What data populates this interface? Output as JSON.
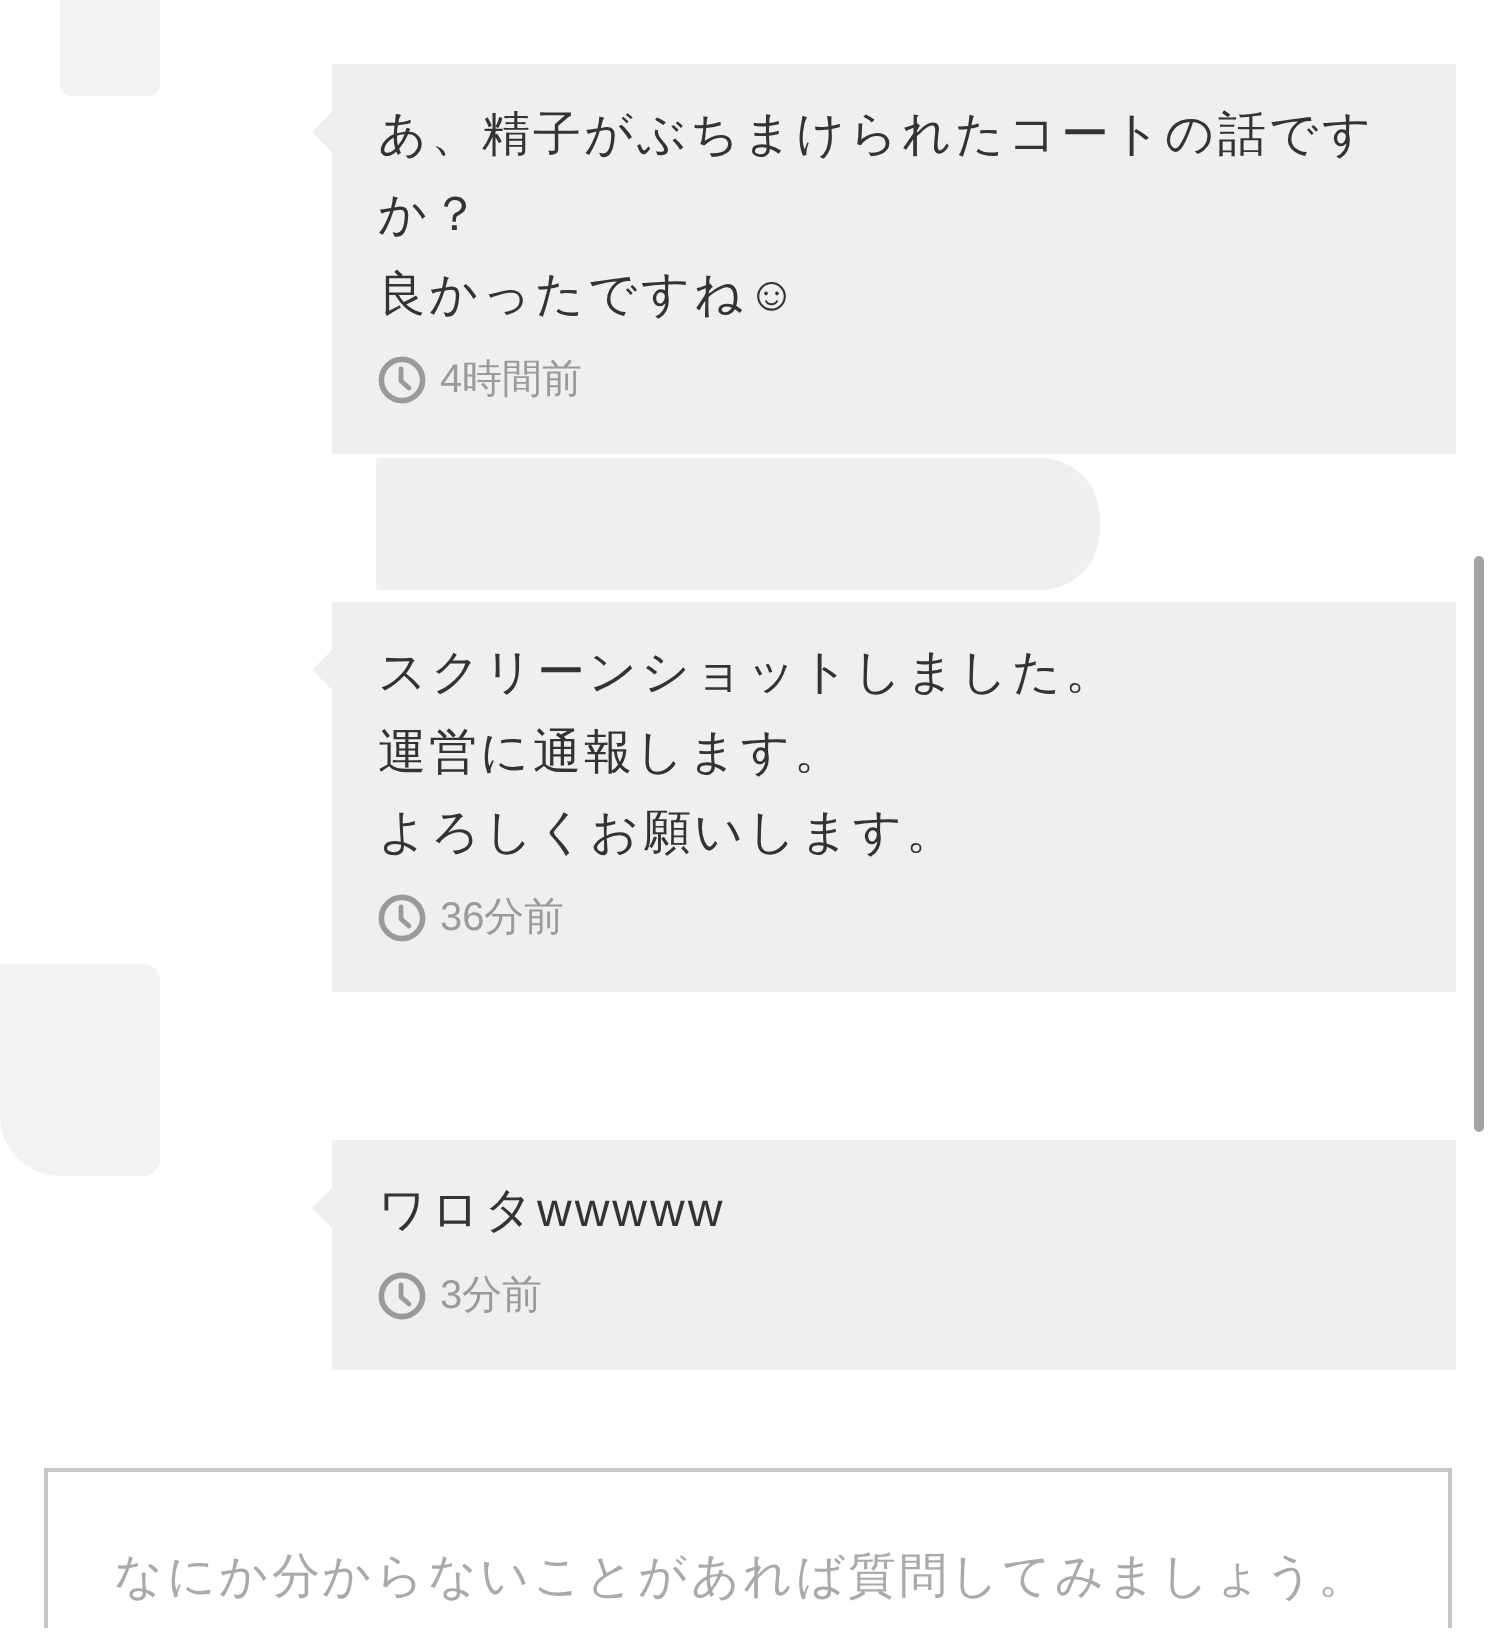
{
  "messages": [
    {
      "lines": [
        "あ、精子がぶちまけられたコートの話ですか？",
        "良かったですね☺"
      ],
      "time": "4時間前"
    },
    {
      "lines": [
        "スクリーンショットしました。",
        "運営に通報します。",
        "よろしくお願いします。"
      ],
      "time": "36分前"
    },
    {
      "lines": [
        "ワロタwwwww"
      ],
      "time": "3分前"
    }
  ],
  "question_field": {
    "placeholder": "なにか分からないことがあれば質問してみましょう。"
  }
}
